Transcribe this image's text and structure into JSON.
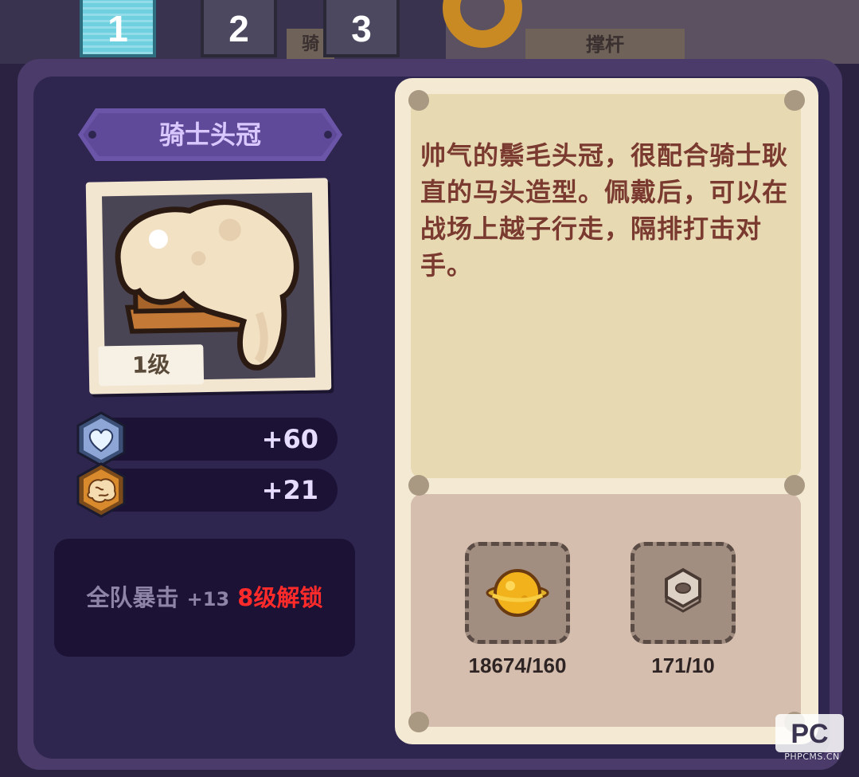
{
  "tabs": [
    {
      "label": "1",
      "active": true
    },
    {
      "label": "2",
      "active": false
    },
    {
      "label": "3",
      "active": false
    }
  ],
  "background": {
    "label_left": "骑",
    "label_right": "撑杆"
  },
  "item": {
    "name": "骑士头冠",
    "level": "1级",
    "image_icon": "knight-mane-crown-icon"
  },
  "stats": [
    {
      "icon": "heart-shield-icon",
      "value": "+60",
      "color": "#8da6d6"
    },
    {
      "icon": "brain-shield-icon",
      "value": "+21",
      "color": "#d88a2c"
    }
  ],
  "bonus": {
    "text": "全队暴击",
    "amount": "+13",
    "unlock": "8级解锁",
    "unlock_color": "#ff2a2a"
  },
  "description": "帅气的鬃毛头冠，很配合骑士耿直的马头造型。佩戴后，可以在战场上越子行走，隔排打击对手。",
  "materials": [
    {
      "icon": "gold-planet-icon",
      "count": "18674/160"
    },
    {
      "icon": "hex-nut-icon",
      "count": "171/10"
    }
  ],
  "watermark": {
    "logo": "PC",
    "text": "PHPCMS.CN"
  }
}
